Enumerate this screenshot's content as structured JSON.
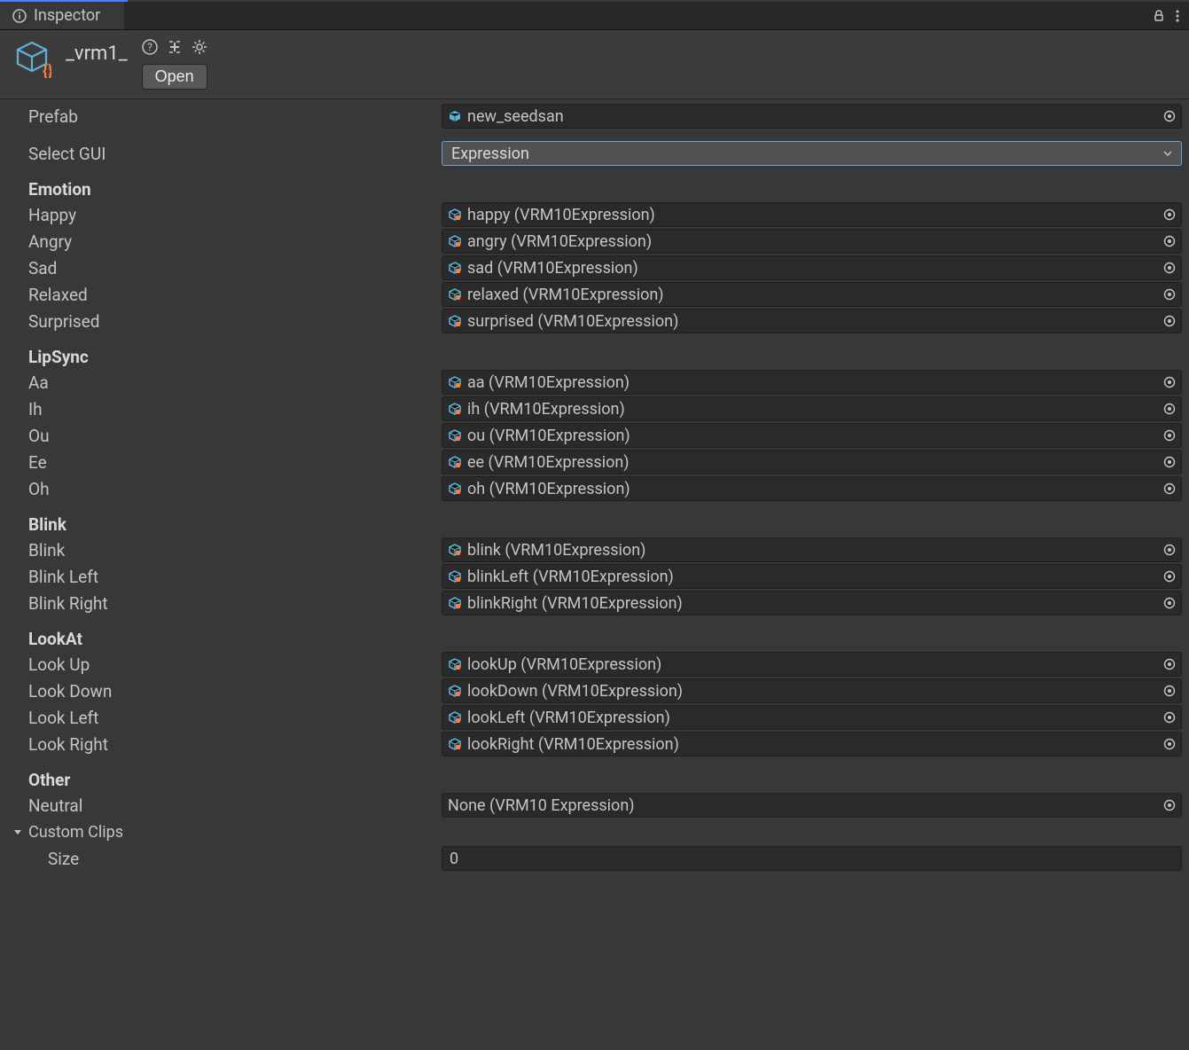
{
  "tab": {
    "title": "Inspector"
  },
  "header": {
    "asset_name": "_vrm1_",
    "open_button": "Open"
  },
  "prefab": {
    "label": "Prefab",
    "value": "new_seedsan"
  },
  "select_gui": {
    "label": "Select GUI",
    "value": "Expression"
  },
  "sections": {
    "emotion": {
      "title": "Emotion",
      "items": [
        {
          "label": "Happy",
          "value": "happy (VRM10Expression)"
        },
        {
          "label": "Angry",
          "value": "angry (VRM10Expression)"
        },
        {
          "label": "Sad",
          "value": "sad (VRM10Expression)"
        },
        {
          "label": "Relaxed",
          "value": "relaxed (VRM10Expression)"
        },
        {
          "label": "Surprised",
          "value": "surprised (VRM10Expression)"
        }
      ]
    },
    "lipsync": {
      "title": "LipSync",
      "items": [
        {
          "label": "Aa",
          "value": "aa (VRM10Expression)"
        },
        {
          "label": "Ih",
          "value": "ih (VRM10Expression)"
        },
        {
          "label": "Ou",
          "value": "ou (VRM10Expression)"
        },
        {
          "label": "Ee",
          "value": "ee (VRM10Expression)"
        },
        {
          "label": "Oh",
          "value": "oh (VRM10Expression)"
        }
      ]
    },
    "blink": {
      "title": "Blink",
      "items": [
        {
          "label": "Blink",
          "value": "blink (VRM10Expression)"
        },
        {
          "label": "Blink Left",
          "value": "blinkLeft (VRM10Expression)"
        },
        {
          "label": "Blink Right",
          "value": "blinkRight (VRM10Expression)"
        }
      ]
    },
    "lookat": {
      "title": "LookAt",
      "items": [
        {
          "label": "Look Up",
          "value": "lookUp (VRM10Expression)"
        },
        {
          "label": "Look Down",
          "value": "lookDown (VRM10Expression)"
        },
        {
          "label": "Look Left",
          "value": "lookLeft (VRM10Expression)"
        },
        {
          "label": "Look Right",
          "value": "lookRight (VRM10Expression)"
        }
      ]
    },
    "other": {
      "title": "Other",
      "neutral": {
        "label": "Neutral",
        "value": "None (VRM10 Expression)"
      },
      "custom_clips": {
        "label": "Custom Clips",
        "size_label": "Size",
        "size_value": "0"
      }
    }
  }
}
